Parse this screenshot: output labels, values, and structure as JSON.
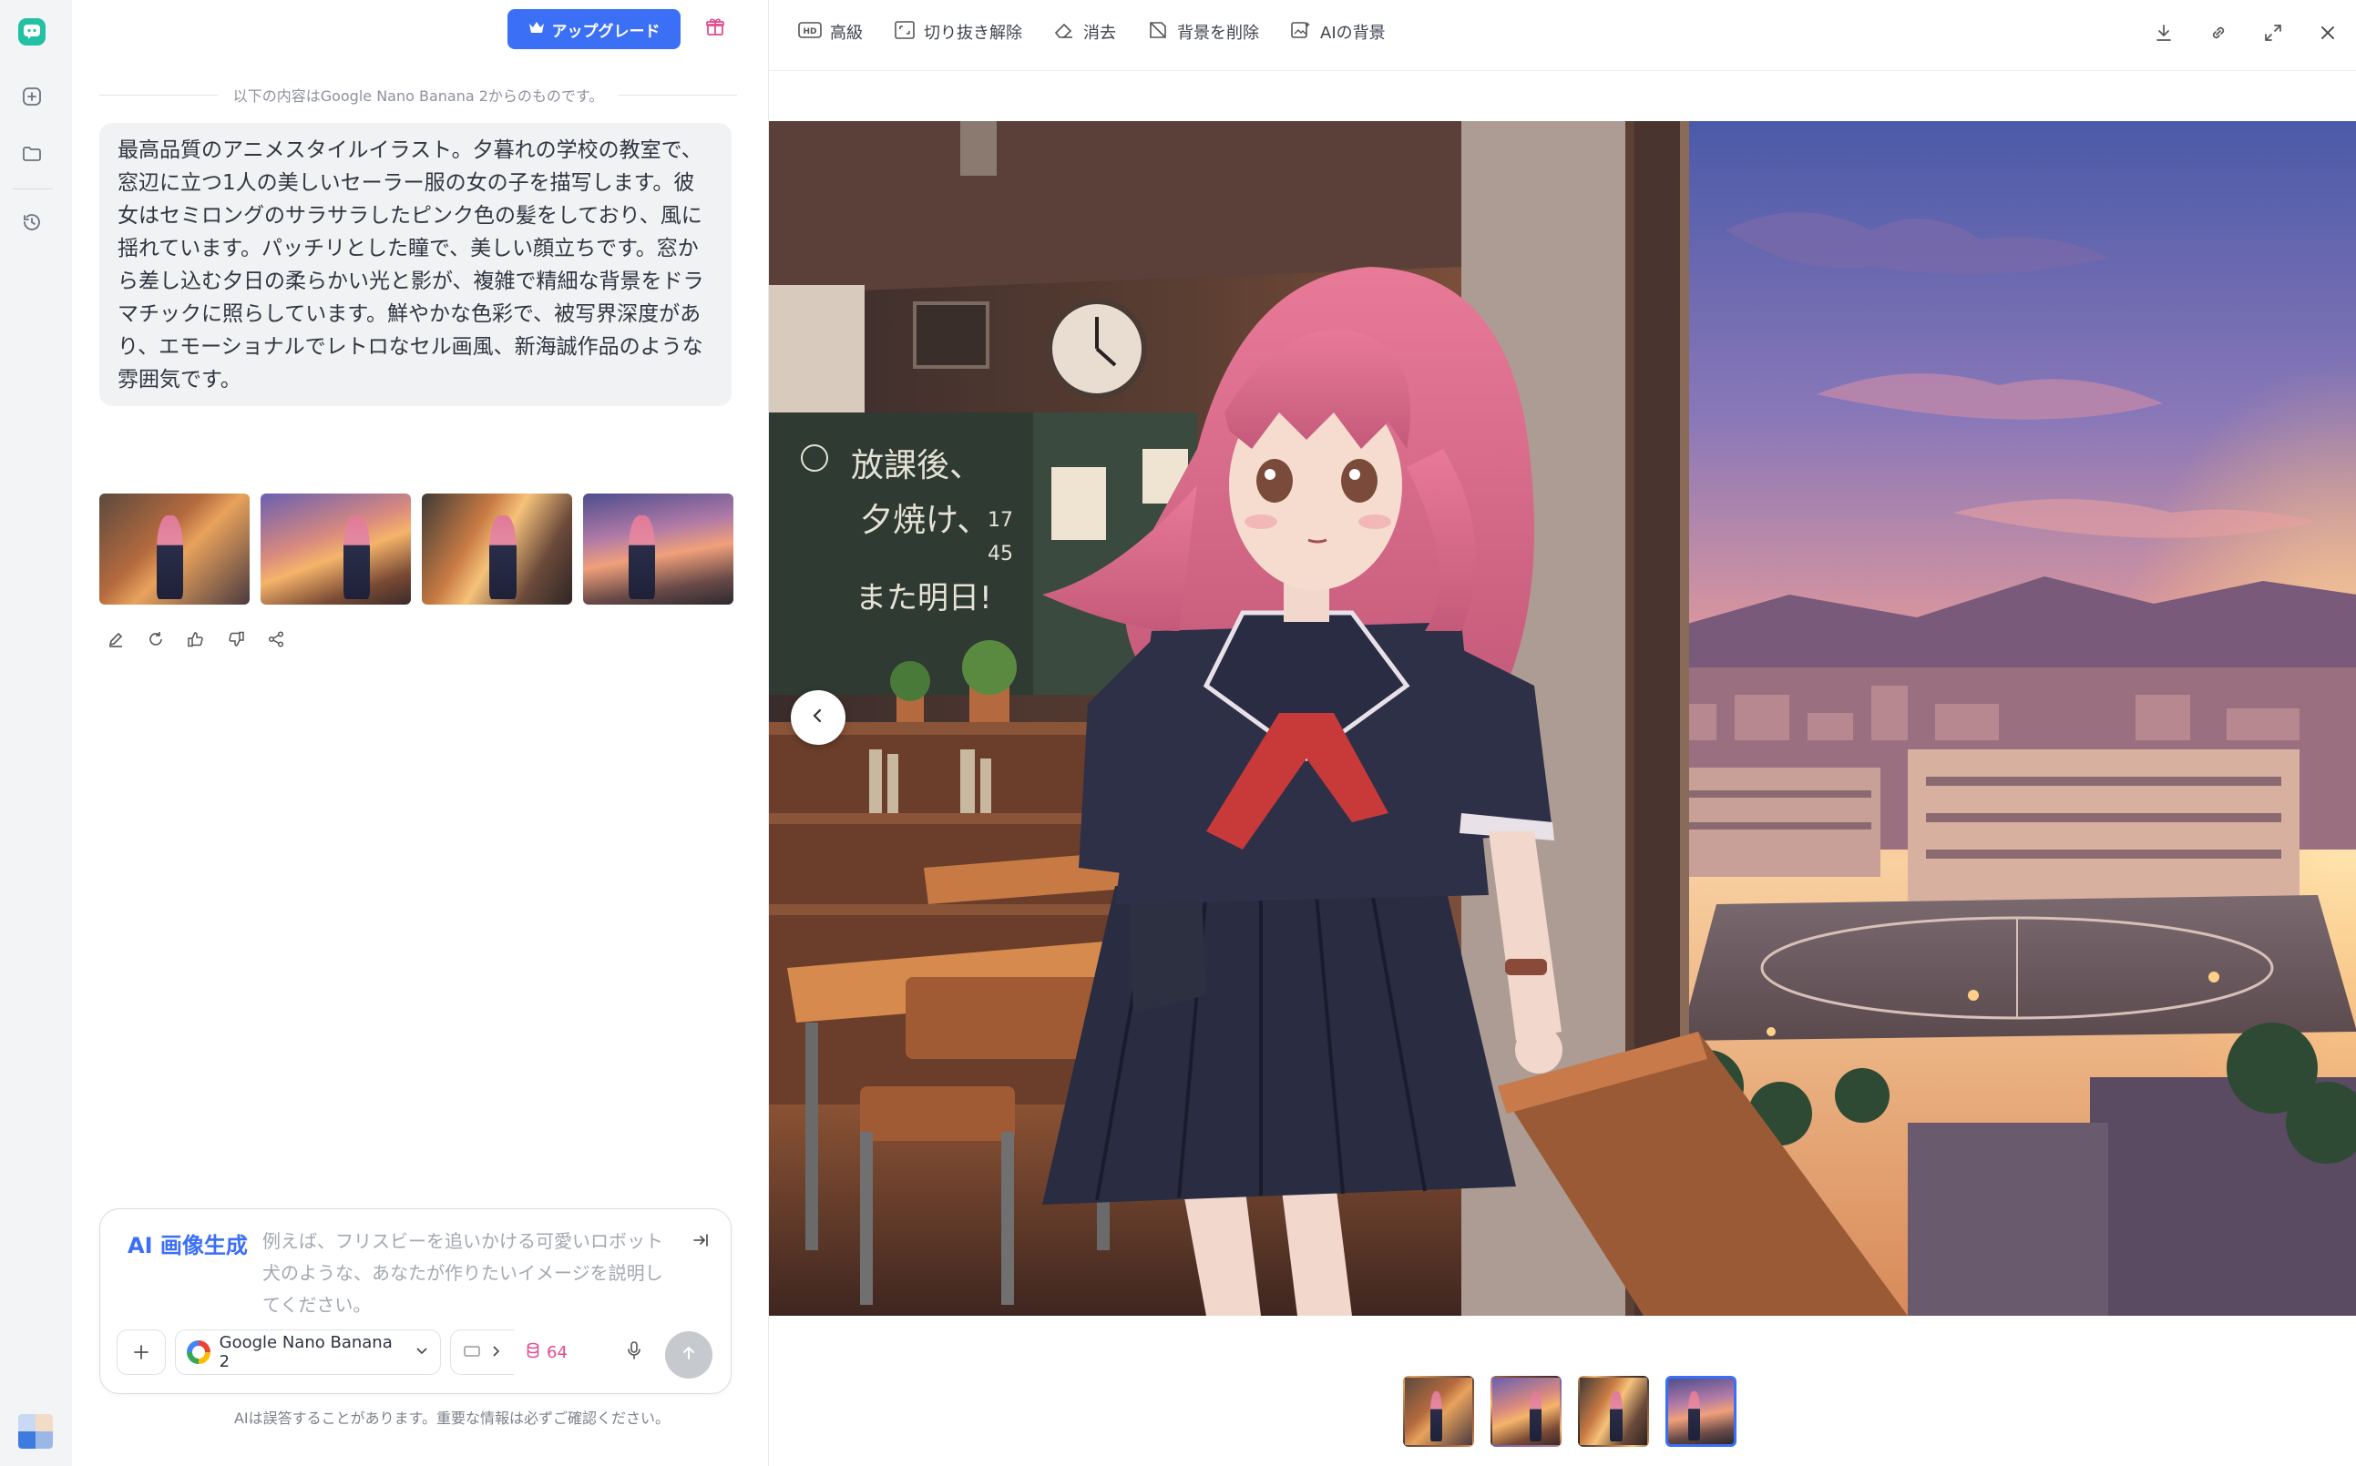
{
  "rail": {
    "logo_icon": "chat-bubble-logo-icon",
    "items": [
      {
        "name": "new-chat",
        "icon": "plus-square-icon"
      },
      {
        "name": "folder",
        "icon": "folder-icon"
      },
      {
        "name": "history",
        "icon": "history-icon"
      }
    ],
    "accent": "#22c1a4"
  },
  "header": {
    "upgrade_label": "アップグレード",
    "gift_icon": "gift-icon"
  },
  "chat": {
    "source_note": "以下の内容はGoogle Nano Banana 2からのものです。",
    "prompt": "最高品質のアニメスタイルイラスト。夕暮れの学校の教室で、窓辺に立つ1人の美しいセーラー服の女の子を描写します。彼女はセミロングのサラサラしたピンク色の髪をしており、風に揺れています。パッチリとした瞳で、美しい顔立ちです。窓から差し込む夕日の柔らかい光と影が、複雑で精細な背景をドラマチックに照らしています。鮮やかな色彩で、被写界深度があり、エモーショナルでレトロなセル画風、新海誠作品のような雰囲気です。",
    "thumbnail_count": 4,
    "actions": [
      "edit-icon",
      "regenerate-icon",
      "thumbs-up-icon",
      "thumbs-down-icon",
      "share-icon"
    ]
  },
  "composer": {
    "label": "AI 画像生成",
    "placeholder": "例えば、フリスビーを追いかける可愛いロボット犬のような、あなたが作りたいイメージを説明してください。",
    "model": "Google Nano Banana 2",
    "credits": "64",
    "disclaimer": "AIは誤答することがあります。重要な情報は必ずご確認ください。"
  },
  "viewer": {
    "tools": [
      {
        "label": "高級",
        "icon": "hd-icon"
      },
      {
        "label": "切り抜き解除",
        "icon": "uncrop-icon"
      },
      {
        "label": "消去",
        "icon": "eraser-icon"
      },
      {
        "label": "背景を削除",
        "icon": "remove-background-icon"
      },
      {
        "label": "AIの背景",
        "icon": "ai-background-icon"
      }
    ],
    "right_tools": [
      "download-icon",
      "link-icon",
      "fullscreen-icon",
      "close-icon"
    ],
    "chalkboard_text": [
      "放課後、",
      "夕焼け、",
      "また明日!"
    ],
    "chalk_numbers": [
      "17",
      "45"
    ],
    "selected_thumbnail": 4
  }
}
